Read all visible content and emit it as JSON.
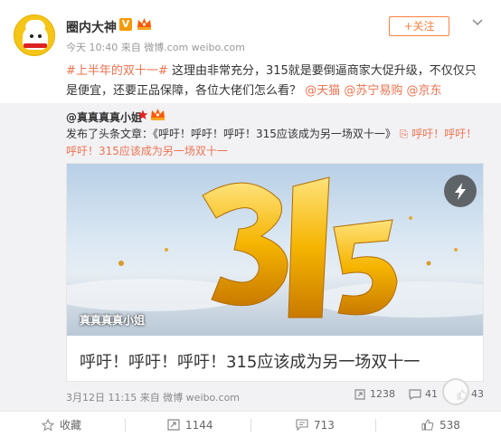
{
  "author": {
    "name": "圈内大神",
    "time": "今天 10:40 来自 微博.com weibo.com",
    "follow_label": "+关注"
  },
  "post": {
    "hashtag": "#上半年的双十一#",
    "text_main": "这理由非常充分，315就是要倒逼商家大促升级，不仅仅只是便宜，还要正品保障，各位大佬们怎么看？",
    "mentions": [
      "@天猫",
      "@苏宁易购",
      "@京东"
    ]
  },
  "repost": {
    "user": "@真真真真小姐",
    "text_prefix": "发布了头条文章：《呼吁！呼吁！呼吁！315应该成为另一场双十一》",
    "link_text": "呼吁！呼吁！呼吁！315应该成为另一场双十一",
    "card": {
      "image_caption": "真真真真小姐",
      "title": "呼吁！呼吁！呼吁！315应该成为另一场双十一",
      "image_numbers": "315"
    },
    "meta": "3月12日 11:15 来自 微博 weibo.com",
    "reposts": "1238",
    "comments": "41",
    "likes": "43"
  },
  "actions": {
    "favorite": "收藏",
    "repost": "1144",
    "comment": "713",
    "like": "538"
  },
  "colors": {
    "accent": "#eb7350",
    "follow": "#ff8140",
    "gold": "#f5c518"
  }
}
